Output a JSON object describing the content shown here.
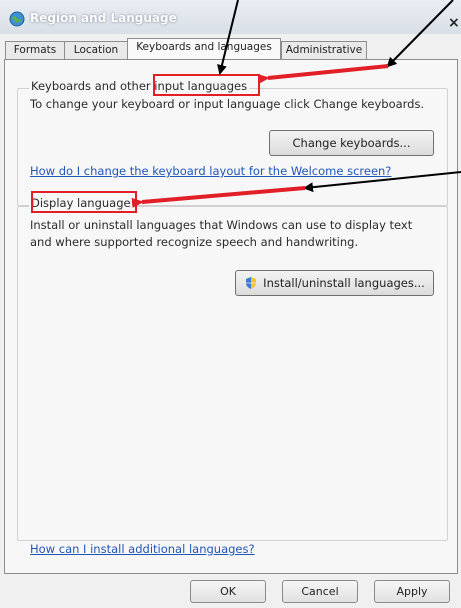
{
  "window": {
    "title": "Region and Language",
    "close_glyph": "×"
  },
  "tabs": [
    {
      "label": "Formats",
      "active": false
    },
    {
      "label": "Location",
      "active": false
    },
    {
      "label": "Keyboards and languages",
      "active": true
    },
    {
      "label": "Administrative",
      "active": false
    }
  ],
  "keyboards_group": {
    "label_prefix": "Keyboards and other ",
    "label_highlight": "input languages",
    "description": "To change your keyboard or input language click Change keyboards.",
    "button_label": "Change keyboards...",
    "help_link": "How do I change the keyboard layout for the Welcome screen?"
  },
  "display_group": {
    "label": "Display language",
    "description_line1": "Install or uninstall languages that Windows can use to display text",
    "description_line2": "and where supported recognize speech and handwriting.",
    "button_label": "Install/uninstall languages...",
    "button_icon": "shield-icon"
  },
  "footer_link": "How can I install additional languages?",
  "dialog_buttons": {
    "ok": "OK",
    "cancel": "Cancel",
    "apply": "Apply"
  },
  "annotation_color": "#e21e26"
}
